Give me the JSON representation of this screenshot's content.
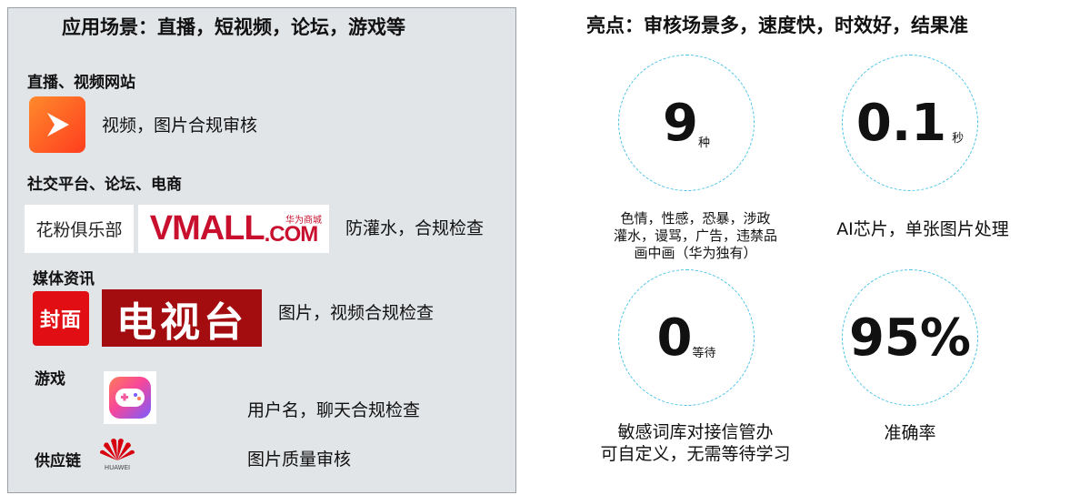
{
  "left": {
    "title": "应用场景：直播，短视频，论坛，游戏等",
    "sections": [
      {
        "category": "直播、视频网站",
        "desc": "视频，图片合规审核"
      },
      {
        "category": "社交平台、论坛、电商",
        "desc": "防灌水，合规检查"
      },
      {
        "category": "媒体资讯",
        "desc": "图片，视频合规检查"
      },
      {
        "category": "游戏",
        "desc": "用户名，聊天合规检查"
      },
      {
        "category": "供应链",
        "desc": "图片质量审核"
      }
    ],
    "logos": {
      "huafen": "花粉俱乐部",
      "vmall": "VMALL",
      "vmall_com": ".COM",
      "vmall_cn": "华为商城",
      "fengmian": "封面",
      "tv": "电视台",
      "huawei": "HUAWEI"
    }
  },
  "right": {
    "title": "亮点：审核场景多，速度快，时效好，结果准",
    "stats": [
      {
        "value": "9",
        "unit": "种",
        "caption": [
          "色情，性感，恐暴，涉政",
          "灌水，谩骂，广告，违禁品",
          "画中画（华为独有）"
        ]
      },
      {
        "value": "0.1",
        "unit": "秒",
        "caption": [
          "AI芯片，单张图片处理"
        ]
      },
      {
        "value": "0",
        "unit": "等待",
        "caption": [
          "敏感词库对接信管办",
          "可自定义，无需等待学习"
        ]
      },
      {
        "value": "95%",
        "unit": "",
        "caption": [
          "准确率"
        ]
      }
    ]
  },
  "colors": {
    "circle_border": "#48c3e6",
    "panel_bg": "#e2e5e8",
    "brand_red": "#c8102e"
  }
}
